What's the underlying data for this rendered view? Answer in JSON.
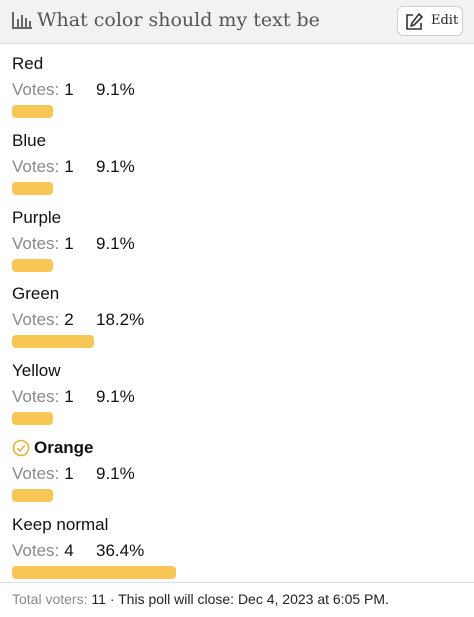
{
  "header": {
    "title": "What color should my text be",
    "edit_label": "Edit"
  },
  "icons": {
    "header": "bar-chart-icon",
    "edit": "edit-pencil-icon",
    "selected": "check-circle-icon"
  },
  "colors": {
    "bar": "#f7c655",
    "selected_check": "#e0b441",
    "header_bg": "#f2f2f2"
  },
  "votes_caption": "Votes:",
  "options": [
    {
      "label": "Red",
      "votes": "1",
      "percent": "9.1%",
      "fraction": 0.091,
      "selected": false
    },
    {
      "label": "Blue",
      "votes": "1",
      "percent": "9.1%",
      "fraction": 0.091,
      "selected": false
    },
    {
      "label": "Purple",
      "votes": "1",
      "percent": "9.1%",
      "fraction": 0.091,
      "selected": false
    },
    {
      "label": "Green",
      "votes": "2",
      "percent": "18.2%",
      "fraction": 0.182,
      "selected": false
    },
    {
      "label": "Yellow",
      "votes": "1",
      "percent": "9.1%",
      "fraction": 0.091,
      "selected": false
    },
    {
      "label": "Orange",
      "votes": "1",
      "percent": "9.1%",
      "fraction": 0.091,
      "selected": true
    },
    {
      "label": "Keep normal",
      "votes": "4",
      "percent": "36.4%",
      "fraction": 0.364,
      "selected": false
    }
  ],
  "footer": {
    "total_label": "Total voters:",
    "total_value": "11",
    "separator": "·",
    "close_text": "This poll will close: Dec 4, 2023 at 6:05 PM."
  }
}
